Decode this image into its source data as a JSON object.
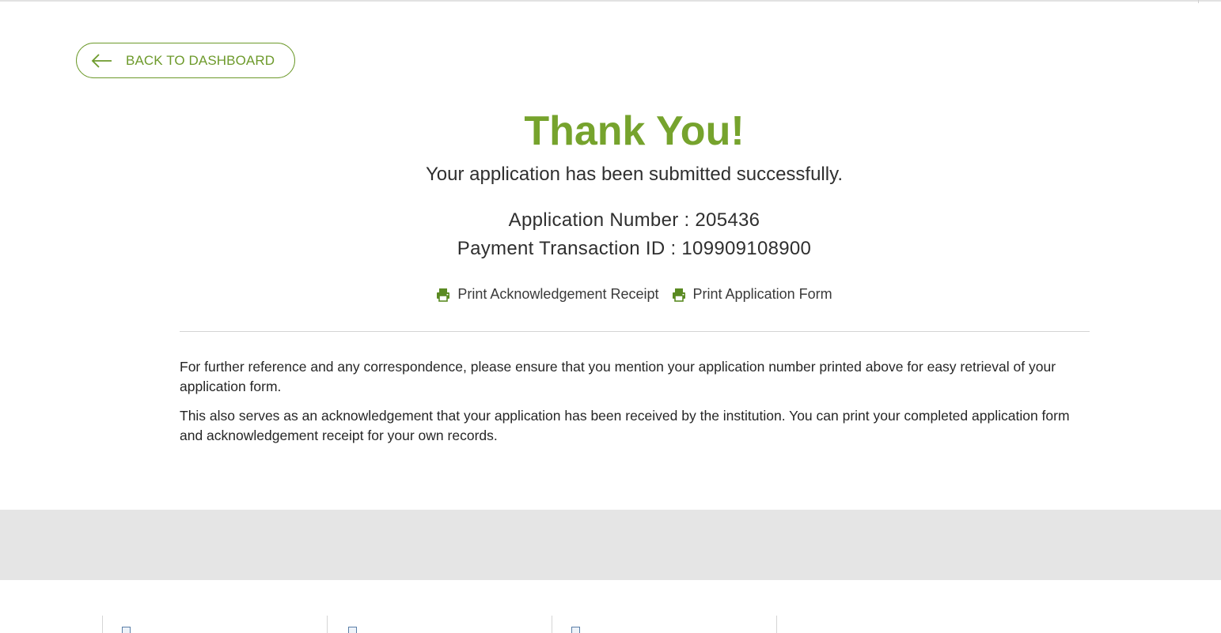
{
  "back_button": {
    "label": "BACK TO DASHBOARD",
    "icon": "arrow-left-icon"
  },
  "confirmation": {
    "title": "Thank You!",
    "subtitle": "Your application has been submitted successfully.",
    "application_number": "Application Number : 205436",
    "transaction_id": "Payment Transaction ID : 109909108900"
  },
  "print_actions": [
    {
      "label": "Print Acknowledgement Receipt",
      "icon": "printer-icon"
    },
    {
      "label": "Print Application Form",
      "icon": "printer-icon"
    }
  ],
  "info": {
    "paragraph_1": "For further reference and any correspondence, please ensure that you mention your application number printed above for easy retrieval of your application form.",
    "paragraph_2": "This also serves as an acknowledgement that your application has been received by the institution. You can print your completed application form and acknowledgement receipt for your own records."
  },
  "colors": {
    "accent_green": "#76a32d",
    "button_green": "#6d9a2b",
    "footer_gray": "#e5e5e5"
  }
}
